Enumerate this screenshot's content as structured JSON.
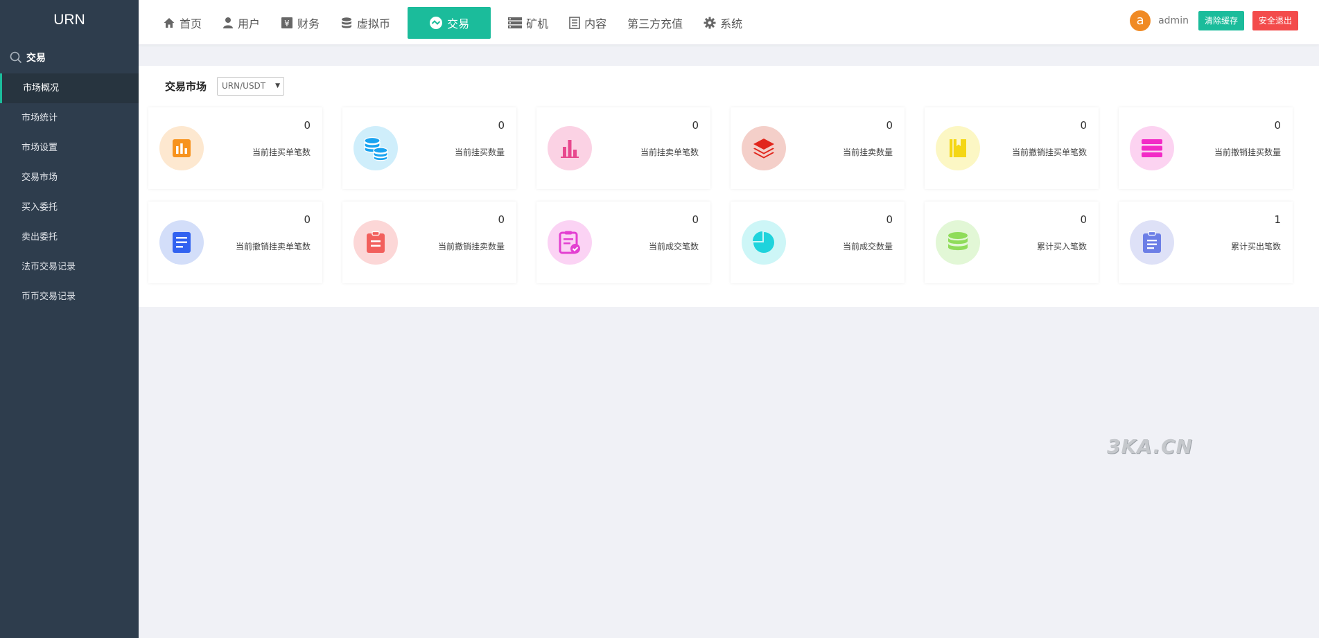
{
  "sidebar": {
    "logo": "URN",
    "section_title": "交易",
    "items": [
      {
        "label": "市场概况",
        "active": true
      },
      {
        "label": "市场统计"
      },
      {
        "label": "市场设置"
      },
      {
        "label": "交易市场"
      },
      {
        "label": "买入委托"
      },
      {
        "label": "卖出委托"
      },
      {
        "label": "法币交易记录"
      },
      {
        "label": "币币交易记录"
      }
    ]
  },
  "topnav": {
    "items": [
      {
        "label": "首页",
        "icon": "home-icon"
      },
      {
        "label": "用户",
        "icon": "user-icon"
      },
      {
        "label": "财务",
        "icon": "yen-icon"
      },
      {
        "label": "虚拟币",
        "icon": "database-icon"
      },
      {
        "label": "交易",
        "icon": "exchange-icon",
        "active": true
      },
      {
        "label": "矿机",
        "icon": "server-icon"
      },
      {
        "label": "内容",
        "icon": "document-icon"
      },
      {
        "label": "第三方充值",
        "icon": ""
      },
      {
        "label": "系统",
        "icon": "gear-icon"
      }
    ],
    "avatar_letter": "a",
    "username": "admin",
    "clear_cache_label": "清除缓存",
    "logout_label": "安全退出"
  },
  "main": {
    "title": "交易市场",
    "market_select": "URN/USDT",
    "cards": [
      {
        "value": "0",
        "label": "当前挂买单笔数",
        "icon": "bar-chart-icon",
        "bg": "#fde8d0",
        "color": "#f7931e"
      },
      {
        "value": "0",
        "label": "当前挂买数量",
        "icon": "coins-icon",
        "bg": "#cfeefb",
        "color": "#1aa3f0"
      },
      {
        "value": "0",
        "label": "当前挂卖单笔数",
        "icon": "column-chart-icon",
        "bg": "#fbd2e4",
        "color": "#e8488e"
      },
      {
        "value": "0",
        "label": "当前挂卖数量",
        "icon": "layers-icon",
        "bg": "#f4cfc9",
        "color": "#e1261c"
      },
      {
        "value": "0",
        "label": "当前撤销挂买单笔数",
        "icon": "book-icon",
        "bg": "#fcf7c4",
        "color": "#f4d614"
      },
      {
        "value": "0",
        "label": "当前撤销挂买数量",
        "icon": "stack-icon",
        "bg": "#fcd3f1",
        "color": "#f22bc6"
      },
      {
        "value": "0",
        "label": "当前撤销挂卖单笔数",
        "icon": "doc-list-icon",
        "bg": "#d3def9",
        "color": "#3162f0"
      },
      {
        "value": "0",
        "label": "当前撤销挂卖数量",
        "icon": "clipboard-icon",
        "bg": "#fcd7d7",
        "color": "#f25f5c"
      },
      {
        "value": "0",
        "label": "当前成交笔数",
        "icon": "clipboard-check-icon",
        "bg": "#fbd3f4",
        "color": "#e33fd1"
      },
      {
        "value": "0",
        "label": "当前成交数量",
        "icon": "pie-chart-icon",
        "bg": "#cdf6f7",
        "color": "#1fd3dc"
      },
      {
        "value": "0",
        "label": "累计买入笔数",
        "icon": "database-icon",
        "bg": "#e2f7d6",
        "color": "#8fdc5a"
      },
      {
        "value": "1",
        "label": "累计买出笔数",
        "icon": "clipboard-list-icon",
        "bg": "#dee1f7",
        "color": "#6c7ee6"
      }
    ]
  },
  "watermark": "3KA.CN"
}
